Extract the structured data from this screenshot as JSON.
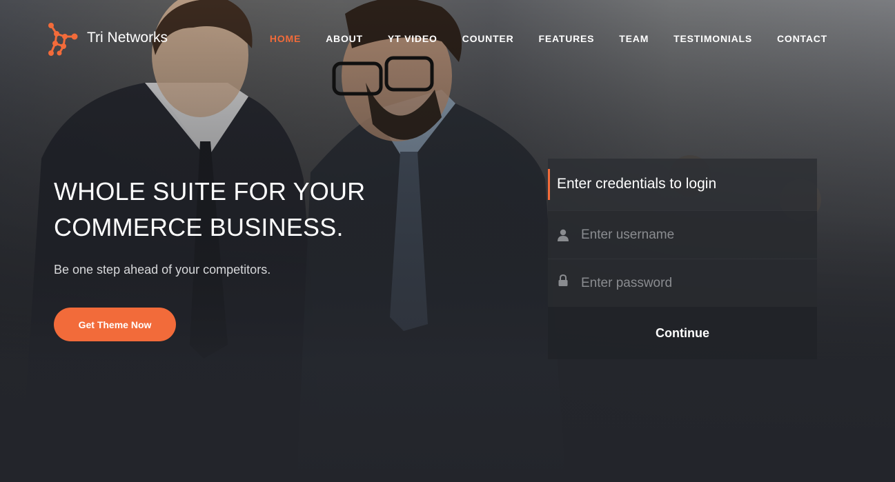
{
  "brand": {
    "name": "Tri Networks",
    "accent_color": "#f26b3a"
  },
  "nav": {
    "items": [
      {
        "label": "HOME",
        "active": true
      },
      {
        "label": "ABOUT"
      },
      {
        "label": "YT VIDEO"
      },
      {
        "label": "COUNTER"
      },
      {
        "label": "FEATURES"
      },
      {
        "label": "TEAM"
      },
      {
        "label": "TESTIMONIALS"
      },
      {
        "label": "CONTACT"
      }
    ]
  },
  "hero": {
    "headline_line1": "WHOLE SUITE FOR YOUR",
    "headline_line2": "COMMERCE BUSINESS.",
    "subheadline": "Be one step ahead of your competitors.",
    "cta_label": "Get Theme Now"
  },
  "login": {
    "title": "Enter credentials to login",
    "username_placeholder": "Enter username",
    "password_placeholder": "Enter password",
    "username_icon": "user-icon",
    "password_icon": "lock-icon",
    "submit_label": "Continue"
  }
}
